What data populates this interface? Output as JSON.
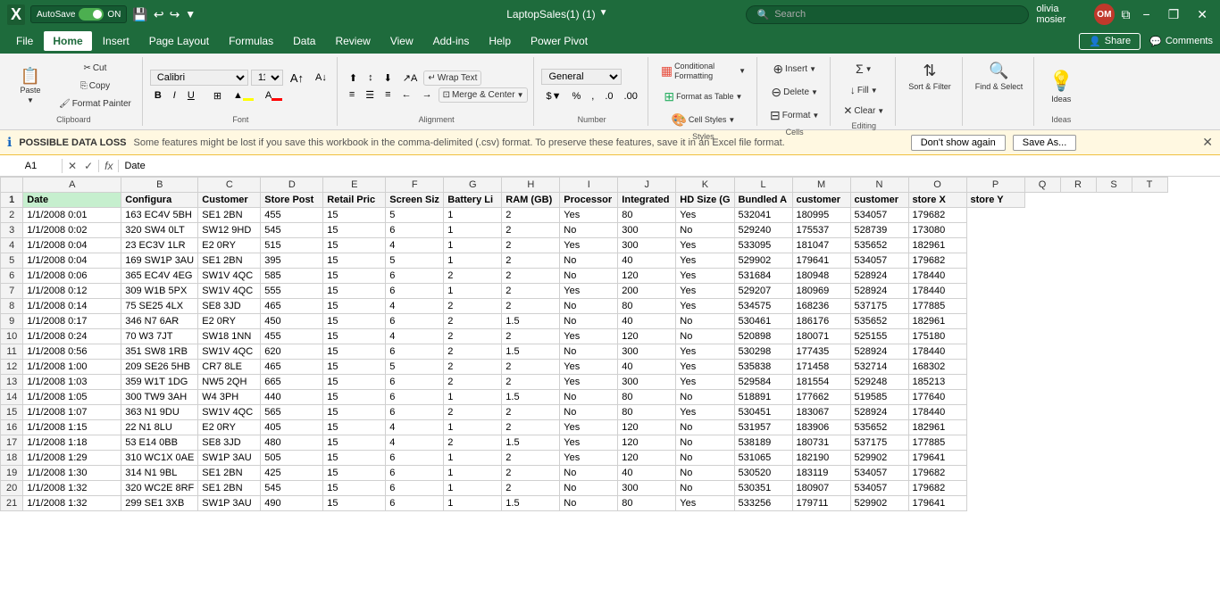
{
  "titleBar": {
    "autosave_label": "AutoSave",
    "autosave_state": "ON",
    "file_name": "LaptopSales(1) (1)",
    "search_placeholder": "Search",
    "user_name": "olivia mosier",
    "user_initials": "OM",
    "minimize": "−",
    "restore": "❐",
    "close": "✕"
  },
  "menuBar": {
    "items": [
      "File",
      "Home",
      "Insert",
      "Page Layout",
      "Formulas",
      "Data",
      "Review",
      "View",
      "Add-ins",
      "Help",
      "Power Pivot"
    ],
    "active": "Home",
    "share_label": "Share",
    "comments_label": "Comments"
  },
  "ribbon": {
    "clipboard": {
      "paste_label": "Paste",
      "cut_label": "Cut",
      "copy_label": "Copy",
      "format_painter_label": "Format Painter",
      "group_label": "Clipboard"
    },
    "font": {
      "font_name": "Calibri",
      "font_size": "11",
      "bold": "B",
      "italic": "I",
      "underline": "U",
      "font_color_label": "A",
      "borders_label": "⊞",
      "fill_label": "🎨",
      "group_label": "Font"
    },
    "alignment": {
      "wrap_text_label": "Wrap Text",
      "merge_label": "Merge & Center",
      "group_label": "Alignment"
    },
    "number": {
      "format_label": "General",
      "percent_label": "%",
      "comma_label": ",",
      "increase_decimal": ".0→.00",
      "decrease_decimal": ".00→.0",
      "group_label": "Number"
    },
    "styles": {
      "conditional_label": "Conditional Formatting",
      "format_table_label": "Format as Table",
      "cell_styles_label": "Cell Styles",
      "group_label": "Styles"
    },
    "cells": {
      "insert_label": "Insert",
      "delete_label": "Delete",
      "format_label": "Format",
      "group_label": "Cells"
    },
    "editing": {
      "sum_label": "Σ",
      "fill_label": "↓ Fill",
      "clear_label": "✕ Clear",
      "sort_label": "Sort & Filter",
      "find_label": "Find & Select",
      "group_label": "Editing"
    },
    "ideas": {
      "label": "Ideas"
    }
  },
  "infoBar": {
    "icon": "ℹ",
    "bold_text": "POSSIBLE DATA LOSS",
    "message": "Some features might be lost if you save this workbook in the comma-delimited (.csv) format. To preserve these features, save it in an Excel file format.",
    "dont_show_label": "Don't show again",
    "save_as_label": "Save As...",
    "close": "✕"
  },
  "formulaBar": {
    "cell_ref": "A1",
    "cancel": "✕",
    "confirm": "✓",
    "fx": "fx",
    "formula": "Date"
  },
  "columns": {
    "letters": [
      "",
      "A",
      "B",
      "C",
      "D",
      "E",
      "F",
      "G",
      "H",
      "I",
      "J",
      "K",
      "L",
      "M",
      "N",
      "O",
      "P",
      "Q",
      "R",
      "S",
      "T"
    ],
    "widths": [
      25,
      110,
      70,
      70,
      70,
      70,
      65,
      65,
      65,
      65,
      65,
      65,
      65,
      65,
      65,
      65,
      65,
      40,
      40,
      40,
      40
    ]
  },
  "headers": [
    "Date",
    "Configura",
    "Customer",
    "Store Post",
    "Retail Pric",
    "Screen Siz",
    "Battery Li",
    "RAM (GB)",
    "Processor",
    "Integrated",
    "HD Size (G",
    "Bundled A",
    "customer",
    "customer",
    "store X",
    "store Y"
  ],
  "rows": [
    [
      "1/1/2008 0:01",
      "163 EC4V 5BH",
      "SE1 2BN",
      "455",
      "15",
      "5",
      "1",
      "2",
      "Yes",
      "80",
      "Yes",
      "532041",
      "180995",
      "534057",
      "179682"
    ],
    [
      "1/1/2008 0:02",
      "320 SW4 0LT",
      "SW12 9HD",
      "545",
      "15",
      "6",
      "1",
      "2",
      "No",
      "300",
      "No",
      "529240",
      "175537",
      "528739",
      "173080"
    ],
    [
      "1/1/2008 0:04",
      "23 EC3V 1LR",
      "E2 0RY",
      "515",
      "15",
      "4",
      "1",
      "2",
      "Yes",
      "300",
      "Yes",
      "533095",
      "181047",
      "535652",
      "182961"
    ],
    [
      "1/1/2008 0:04",
      "169 SW1P 3AU",
      "SE1 2BN",
      "395",
      "15",
      "5",
      "1",
      "2",
      "No",
      "40",
      "Yes",
      "529902",
      "179641",
      "534057",
      "179682"
    ],
    [
      "1/1/2008 0:06",
      "365 EC4V 4EG",
      "SW1V 4QC",
      "585",
      "15",
      "6",
      "2",
      "2",
      "No",
      "120",
      "Yes",
      "531684",
      "180948",
      "528924",
      "178440"
    ],
    [
      "1/1/2008 0:12",
      "309 W1B 5PX",
      "SW1V 4QC",
      "555",
      "15",
      "6",
      "1",
      "2",
      "Yes",
      "200",
      "Yes",
      "529207",
      "180969",
      "528924",
      "178440"
    ],
    [
      "1/1/2008 0:14",
      "75 SE25 4LX",
      "SE8 3JD",
      "465",
      "15",
      "4",
      "2",
      "2",
      "No",
      "80",
      "Yes",
      "534575",
      "168236",
      "537175",
      "177885"
    ],
    [
      "1/1/2008 0:17",
      "346 N7 6AR",
      "E2 0RY",
      "450",
      "15",
      "6",
      "2",
      "1.5",
      "No",
      "40",
      "No",
      "530461",
      "186176",
      "535652",
      "182961"
    ],
    [
      "1/1/2008 0:24",
      "70 W3 7JT",
      "SW18 1NN",
      "455",
      "15",
      "4",
      "2",
      "2",
      "Yes",
      "120",
      "No",
      "520898",
      "180071",
      "525155",
      "175180"
    ],
    [
      "1/1/2008 0:56",
      "351 SW8 1RB",
      "SW1V 4QC",
      "620",
      "15",
      "6",
      "2",
      "1.5",
      "No",
      "300",
      "Yes",
      "530298",
      "177435",
      "528924",
      "178440"
    ],
    [
      "1/1/2008 1:00",
      "209 SE26 5HB",
      "CR7 8LE",
      "465",
      "15",
      "5",
      "2",
      "2",
      "Yes",
      "40",
      "Yes",
      "535838",
      "171458",
      "532714",
      "168302"
    ],
    [
      "1/1/2008 1:03",
      "359 W1T 1DG",
      "NW5 2QH",
      "665",
      "15",
      "6",
      "2",
      "2",
      "Yes",
      "300",
      "Yes",
      "529584",
      "181554",
      "529248",
      "185213"
    ],
    [
      "1/1/2008 1:05",
      "300 TW9 3AH",
      "W4 3PH",
      "440",
      "15",
      "6",
      "1",
      "1.5",
      "No",
      "80",
      "No",
      "518891",
      "177662",
      "519585",
      "177640"
    ],
    [
      "1/1/2008 1:07",
      "363 N1 9DU",
      "SW1V 4QC",
      "565",
      "15",
      "6",
      "2",
      "2",
      "No",
      "80",
      "Yes",
      "530451",
      "183067",
      "528924",
      "178440"
    ],
    [
      "1/1/2008 1:15",
      "22 N1 8LU",
      "E2 0RY",
      "405",
      "15",
      "4",
      "1",
      "2",
      "Yes",
      "120",
      "No",
      "531957",
      "183906",
      "535652",
      "182961"
    ],
    [
      "1/1/2008 1:18",
      "53 E14 0BB",
      "SE8 3JD",
      "480",
      "15",
      "4",
      "2",
      "1.5",
      "Yes",
      "120",
      "No",
      "538189",
      "180731",
      "537175",
      "177885"
    ],
    [
      "1/1/2008 1:29",
      "310 WC1X 0AE",
      "SW1P 3AU",
      "505",
      "15",
      "6",
      "1",
      "2",
      "Yes",
      "120",
      "No",
      "531065",
      "182190",
      "529902",
      "179641"
    ],
    [
      "1/1/2008 1:30",
      "314 N1 9BL",
      "SE1 2BN",
      "425",
      "15",
      "6",
      "1",
      "2",
      "No",
      "40",
      "No",
      "530520",
      "183119",
      "534057",
      "179682"
    ],
    [
      "1/1/2008 1:32",
      "320 WC2E 8RF",
      "SE1 2BN",
      "545",
      "15",
      "6",
      "1",
      "2",
      "No",
      "300",
      "No",
      "530351",
      "180907",
      "534057",
      "179682"
    ],
    [
      "1/1/2008 1:32",
      "299 SE1 3XB",
      "SW1P 3AU",
      "490",
      "15",
      "6",
      "1",
      "1.5",
      "No",
      "80",
      "Yes",
      "533256",
      "179711",
      "529902",
      "179641"
    ]
  ],
  "rowNumbers": [
    1,
    2,
    3,
    4,
    5,
    6,
    7,
    8,
    9,
    10,
    11,
    12,
    13,
    14,
    15,
    16,
    17,
    18,
    19,
    20,
    21
  ]
}
